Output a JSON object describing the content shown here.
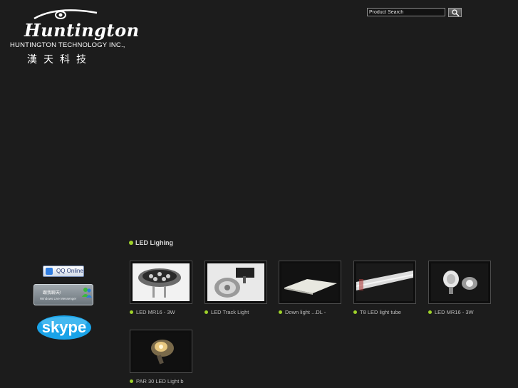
{
  "brand": {
    "logo_text": "Huntington",
    "company_name": "HUNTINGTON TECHNOLOGY INC.,",
    "company_chinese": "漢天科技"
  },
  "search": {
    "placeholder": "Product Search",
    "button_icon": "magnifier-icon"
  },
  "section": {
    "title": "LED Lighing"
  },
  "sidebar": {
    "qq_label": "QQ Online",
    "msn_line1": "跟我聊天!",
    "msn_line2": "Windows Live Messenger",
    "skype_label": "skype"
  },
  "products": [
    {
      "caption": "LED MR16 - 3W"
    },
    {
      "caption": "LED Track Light"
    },
    {
      "caption": "Down light ...DL -"
    },
    {
      "caption": "T8 LED light tube"
    },
    {
      "caption": "LED MR16 - 3W"
    },
    {
      "caption": "PAR 30 LED Light b"
    }
  ],
  "colors": {
    "background": "#1c1c1c",
    "bullet_accent": "#9fd22a",
    "text": "#c8c8c8"
  }
}
